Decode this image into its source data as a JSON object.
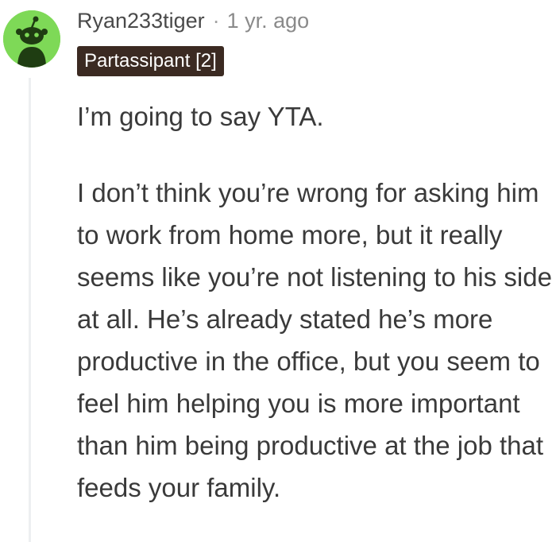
{
  "comment": {
    "author": "Ryan233tiger",
    "separator": "·",
    "age": "1 yr. ago",
    "flair": "Partassipant [2]",
    "paragraphs": [
      "I’m going to say YTA.",
      "I don’t think you’re wrong for asking him to work from home more, but it really seems like you’re not listening to his side at all. He’s already stated he’s more productive in the office, but you seem to feel him helping you is more important than him being productive at the job that feeds your family."
    ]
  },
  "colors": {
    "avatar_background": "#7ed957",
    "flair_background": "#3b2a22",
    "thread_line": "#edeff1"
  },
  "icons": {
    "avatar": "snoo-avatar-icon"
  }
}
